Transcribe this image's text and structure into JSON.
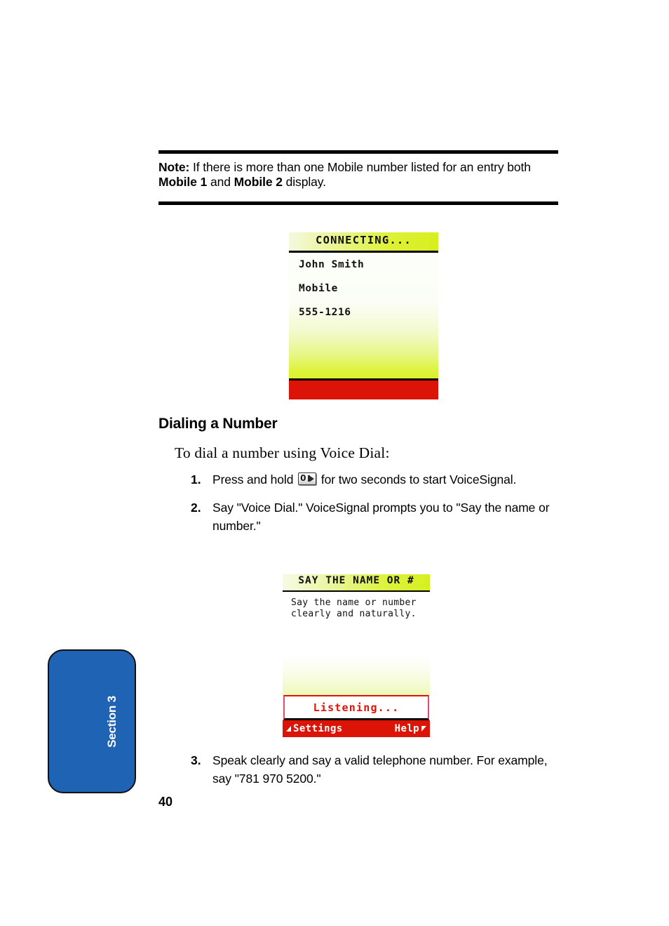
{
  "page": {
    "number": "40",
    "section_tab_label": "Section 3"
  },
  "note": {
    "label": "Note:",
    "text_part1": " If there is more than one Mobile number listed for an entry both ",
    "bold1": "Mobile 1",
    "mid": " and ",
    "bold2": "Mobile 2",
    "text_part2": " display."
  },
  "screen1": {
    "header_title": "CONNECTING...",
    "line1": "John Smith",
    "line2": "Mobile",
    "line3": "555-1216",
    "footer_color": "#dc1408",
    "accent_color": "#d8f22a"
  },
  "section": {
    "heading": "Dialing a Number",
    "intro": "To dial a number using Voice Dial:"
  },
  "steps": [
    {
      "num": "1.",
      "text_before": "Press and hold ",
      "icon": "voice-key-icon",
      "key_label": "0",
      "text_after": " for two seconds to start VoiceSignal."
    },
    {
      "num": "2.",
      "text": "Say \"Voice Dial.\" VoiceSignal prompts you to \"Say the name or number.\""
    },
    {
      "num": "3.",
      "text": "Speak clearly and say a valid telephone number. For example, say \"781 970 5200.\""
    }
  ],
  "screen2": {
    "header_title": "SAY THE NAME OR #",
    "prompt_line1": "Say the name or number",
    "prompt_line2": "clearly and naturally.",
    "listening_label": "Listening...",
    "softkey_left": "Settings",
    "softkey_right": "Help",
    "status_color": "#dc1408"
  }
}
